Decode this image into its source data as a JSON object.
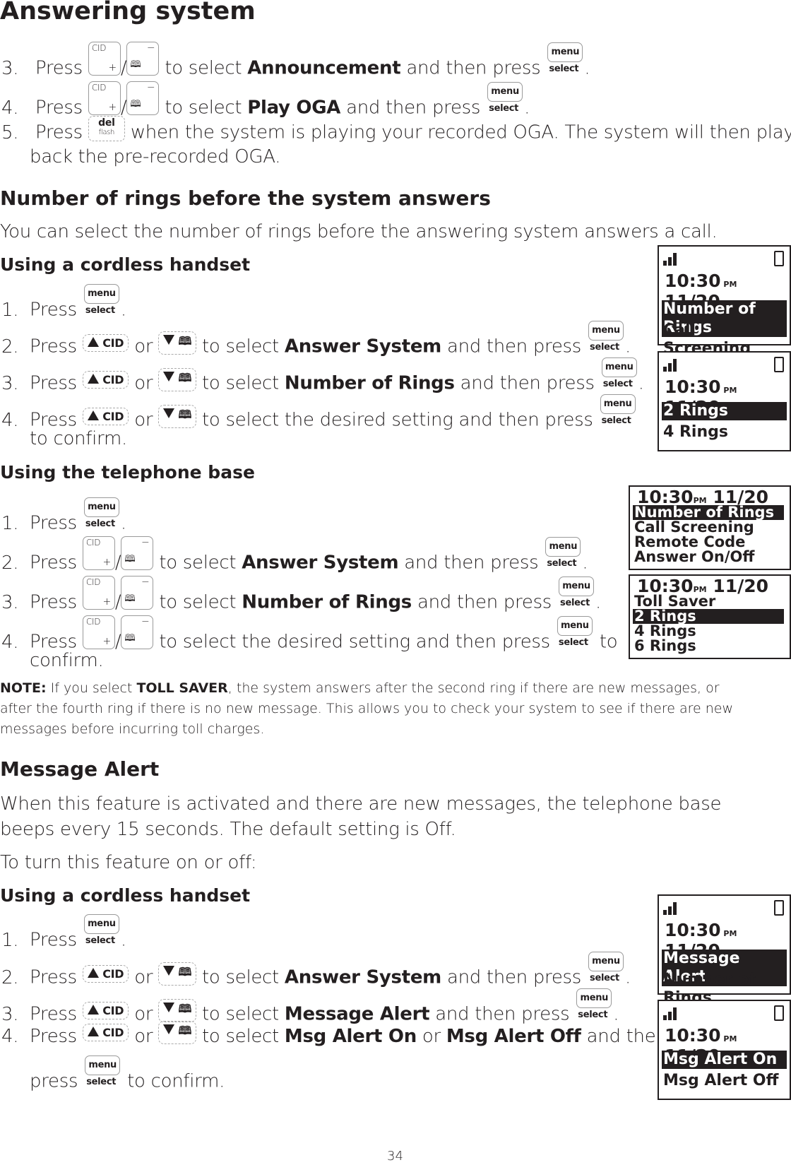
{
  "page": {
    "title": "Answering system",
    "page_number": "34"
  },
  "keys": {
    "cid": "CID",
    "plus": "+",
    "minus": "−",
    "book": "🕮",
    "slash": "/",
    "menu": "menu",
    "select": "select",
    "del": "del",
    "flash": "flash",
    "icons": {
      "up": "triangle-up-plus-icon",
      "down": "triangle-down-minus-icon",
      "phonebook": "phonebook-icon"
    }
  },
  "intro_steps": [
    {
      "n": "3.",
      "pre": "Press",
      "mid": "to select",
      "bold": "Announcement",
      "post": "and then press",
      "end": "."
    },
    {
      "n": "4.",
      "pre": "Press",
      "mid": "to select",
      "bold": "Play OGA",
      "post": "and then press",
      "end": "."
    },
    {
      "n": "5.",
      "pre": "Press",
      "line1": "when the system is playing your recorded OGA. The system will then play",
      "line2": "back the pre-recorded OGA."
    }
  ],
  "rings": {
    "heading": "Number of rings before the system answers",
    "description": "You can select the number of rings before the answering system answers a call.",
    "handset": {
      "heading": "Using a cordless handset",
      "steps": [
        {
          "n": "1.",
          "pre": "Press",
          "end": "."
        },
        {
          "n": "2.",
          "pre": "Press",
          "or": "or",
          "mid": "to select",
          "bold": "Answer System",
          "post": "and then press",
          "end": "."
        },
        {
          "n": "3.",
          "pre": "Press",
          "or": "or",
          "mid": "to select",
          "bold": "Number of Rings",
          "post": "and then press",
          "end": "."
        },
        {
          "n": "4.",
          "pre": "Press",
          "or": "or",
          "mid": "to select the desired setting and then press",
          "line2": "to confirm."
        }
      ]
    },
    "base": {
      "heading": "Using the telephone base",
      "steps": [
        {
          "n": "1.",
          "pre": "Press",
          "end": "."
        },
        {
          "n": "2.",
          "pre": "Press",
          "mid": "to select",
          "bold": "Answer System",
          "post": "and then press",
          "end": "."
        },
        {
          "n": "3.",
          "pre": "Press",
          "mid": "to select",
          "bold": "Number of Rings",
          "post": "and then press",
          "end": "."
        },
        {
          "n": "4.",
          "pre": "Press",
          "mid": "to select the desired setting and then press",
          "post": "to",
          "line2": "confirm."
        }
      ]
    },
    "note": {
      "label": "NOTE:",
      "pre": "If you select",
      "bold": "TOLL SAVER",
      "line1": ", the system answers after the second ring if there are new messages, or",
      "line2": "after the fourth ring if there is no new message. This allows you to check your system to see if there are new",
      "line3": "messages before incurring toll charges."
    }
  },
  "alert": {
    "heading": "Message Alert",
    "line1": "When this feature is activated and there are new messages, the telephone base",
    "line2": "beeps every 15 seconds. The default setting is Off.",
    "line3": "To turn this feature on or off:",
    "handset": {
      "heading": "Using a cordless handset",
      "steps": [
        {
          "n": "1.",
          "pre": "Press",
          "end": "."
        },
        {
          "n": "2.",
          "pre": "Press",
          "or": "or",
          "mid": "to select",
          "bold": "Answer System",
          "post": "and then press",
          "end": "."
        },
        {
          "n": "3.",
          "pre": "Press",
          "or": "or",
          "mid": "to select",
          "bold": "Message Alert",
          "post": "and then press",
          "end": "."
        },
        {
          "n": "4.",
          "pre": "Press",
          "or": "or",
          "mid": "to select",
          "bold": "Msg Alert On",
          "or2": "or",
          "bold2": "Msg Alert Off",
          "post": "and then",
          "line2_pre": "press",
          "line2_post": "to confirm."
        }
      ]
    }
  },
  "screens": {
    "time": "10:30",
    "ampm": "PM",
    "date": "11/20",
    "handset_rings_1": {
      "items": [
        "Number of Rings",
        "Call Screening"
      ],
      "selected": 0
    },
    "handset_rings_2": {
      "items": [
        "2 Rings",
        "4 Rings"
      ],
      "selected": 0
    },
    "base_rings_1": {
      "items": [
        "Number of Rings",
        "Call Screening",
        "Remote Code",
        "Answer On/Off"
      ],
      "selected": 0
    },
    "base_rings_2": {
      "items": [
        "Toll Saver",
        "2 Rings",
        "4 Rings",
        "6 Rings"
      ],
      "selected": 1
    },
    "alert_1": {
      "items": [
        "Message Alert",
        "Number of Rings"
      ],
      "selected": 0
    },
    "alert_2": {
      "items": [
        "Msg Alert On",
        "Msg Alert Off"
      ],
      "selected": 0
    }
  }
}
